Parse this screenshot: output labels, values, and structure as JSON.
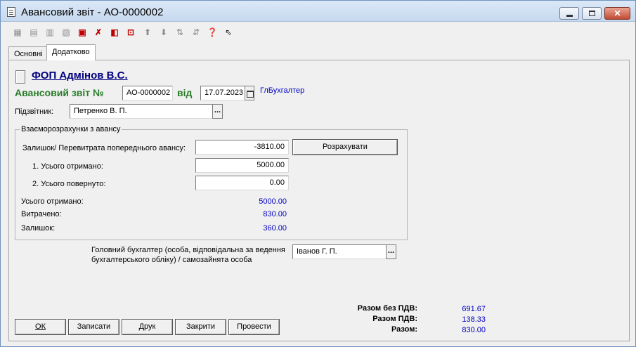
{
  "window": {
    "title": "Авансовий звіт - АО-0000002",
    "close_glyph": "✕"
  },
  "tabs": [
    "Основні",
    "Додатково"
  ],
  "header": {
    "company": "ФОП Адмінов В.С.",
    "doc_label": "Авансовий звіт №",
    "doc_number": "АО-0000002",
    "date_label": "від",
    "date": "17.07.2023",
    "role_link": "ГлБухгалтер"
  },
  "reporter": {
    "label": "Підзвітник:",
    "value": "Петренко В. П.",
    "dots": "..."
  },
  "settlements": {
    "legend": "Взаєморозрахунки з авансу",
    "prev_balance_label": "Залишок/ Перевитрата попереднього авансу:",
    "prev_balance_value": "-3810.00",
    "calculate_label": "Розрахувати",
    "received_label": "1. Усього отримано:",
    "received_value": "5000.00",
    "returned_label": "2. Усього повернуто:",
    "returned_value": "0.00",
    "total_received_label": "Усього отримано:",
    "total_received_value": "5000.00",
    "spent_label": "Витрачено:",
    "spent_value": "830.00",
    "remainder_label": "Залишок:",
    "remainder_value": "360.00"
  },
  "accountant": {
    "label_line1": "Головний бухгалтер (особа, відповідальна за ведення",
    "label_line2": "бухгалтерського обліку) / самозайнята особа",
    "value": "Іванов Г. П.",
    "dots": "..."
  },
  "totals": {
    "without_vat_label": "Разом без ПДВ:",
    "without_vat_value": "691.67",
    "vat_label": "Разом ПДВ:",
    "vat_value": "138.33",
    "total_label": "Разом:",
    "total_value": "830.00"
  },
  "buttons": {
    "ok": "ОК",
    "save": "Записати",
    "print": "Друк",
    "close": "Закрити",
    "post": "Провести"
  },
  "toolbar_icons": [
    "add-row-icon",
    "insert-row-icon",
    "delete-row-icon",
    "copy-row-icon",
    "red-doc-icon",
    "dk-icon",
    "document-edit-icon",
    "frame-icon",
    "move-up-icon",
    "move-down-icon",
    "sort-ascending-icon",
    "sort-descending-icon",
    "help-icon",
    "context-help-icon"
  ]
}
